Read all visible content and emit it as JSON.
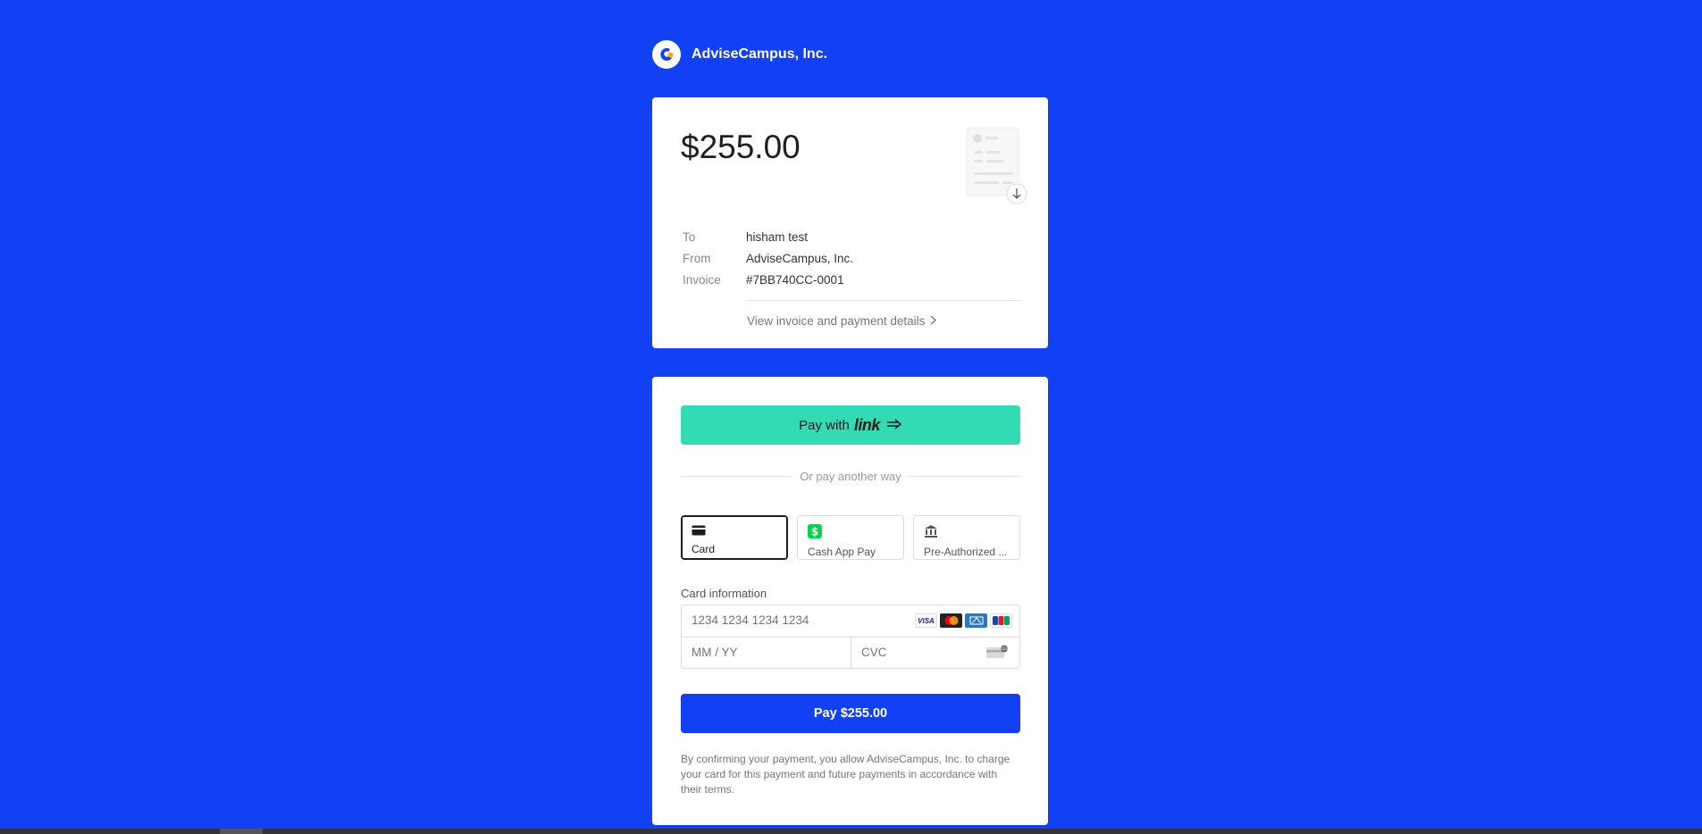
{
  "header": {
    "company_name": "AdviseCampus, Inc."
  },
  "invoice": {
    "amount": "$255.00",
    "rows": [
      {
        "label": "To",
        "value": "hisham test"
      },
      {
        "label": "From",
        "value": "AdviseCampus, Inc."
      },
      {
        "label": "Invoice",
        "value": "#7BB740CC-0001"
      }
    ],
    "view_link": "View invoice and payment details"
  },
  "payment": {
    "link_button": {
      "prefix": "Pay with",
      "brand": "link"
    },
    "divider_text": "Or pay another way",
    "methods": [
      {
        "label": "Card",
        "icon": "card-icon",
        "selected": true
      },
      {
        "label": "Cash App Pay",
        "icon": "cash-app-icon",
        "selected": false
      },
      {
        "label": "Pre-Authorized ...",
        "icon": "bank-icon",
        "selected": false
      }
    ],
    "card_info_label": "Card information",
    "card_number_placeholder": "1234 1234 1234 1234",
    "expiry_placeholder": "MM / YY",
    "cvc_placeholder": "CVC",
    "brands": [
      "VISA",
      "mastercard",
      "amex",
      "JCB"
    ],
    "pay_button": "Pay $255.00",
    "legal_text": "By confirming your payment, you allow AdviseCampus, Inc. to charge your card for this payment and future payments in accordance with their terms."
  },
  "colors": {
    "background": "#1140f5",
    "link_green": "#33dbb4",
    "pay_button": "#1140f5",
    "cash_app_green": "#00d64f"
  }
}
